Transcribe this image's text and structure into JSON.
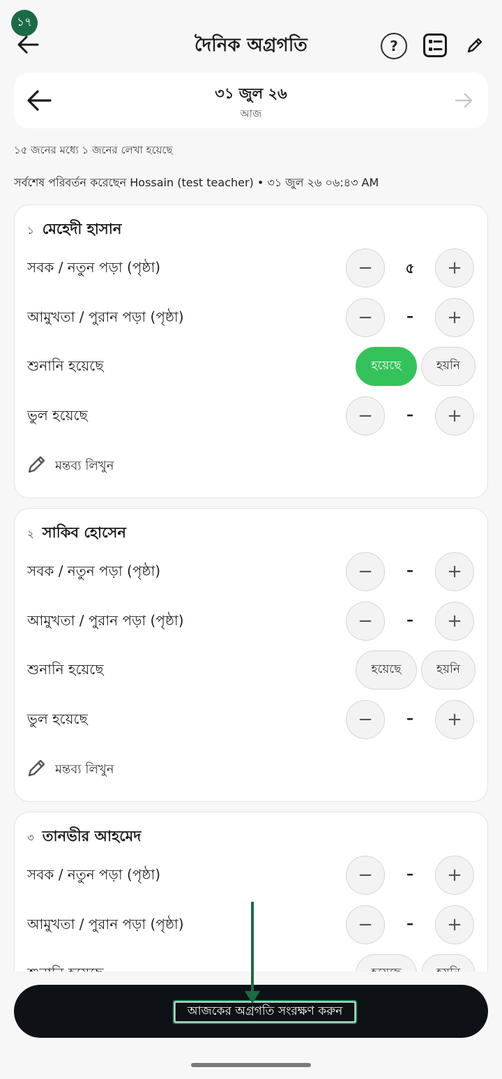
{
  "step_badge": "১৭",
  "header": {
    "title": "দৈনিক অগ্রগতি",
    "help_glyph": "?",
    "icons": [
      "back-arrow-icon",
      "help-icon",
      "list-icon",
      "pencil-icon"
    ]
  },
  "date_nav": {
    "date": "৩১ জুল ২৬",
    "sub": "আজ"
  },
  "summary": {
    "written": "১৫ জনের মধ্যে ১ জনের লেখা হয়েছে",
    "last_modified": "সর্বশেষ পরিবর্তন করেছেন Hossain (test teacher) • ৩১ জুল ২৬ ০৬:৪৩ AM"
  },
  "controls": {
    "minus": "−",
    "plus": "+",
    "comment_label": "মন্তব্য লিখুন"
  },
  "students": [
    {
      "index": "১",
      "name": "মেহেদী হাসান",
      "rows": [
        {
          "label": "সবক / নতুন পড়া (পৃষ্ঠা)",
          "value": "৫"
        },
        {
          "label": "আমুখতা / পুরান পড়া (পৃষ্ঠা)",
          "value": "–"
        },
        {
          "label": "শুনানি হয়েছে",
          "yes": "হয়েছে",
          "no": "হয়নি",
          "selected": "yes"
        },
        {
          "label": "ভুল হয়েছে",
          "value": "–"
        }
      ]
    },
    {
      "index": "২",
      "name": "সাকিব হোসেন",
      "rows": [
        {
          "label": "সবক / নতুন পড়া (পৃষ্ঠা)",
          "value": "–"
        },
        {
          "label": "আমুখতা / পুরান পড়া (পৃষ্ঠা)",
          "value": "–"
        },
        {
          "label": "শুনানি হয়েছে",
          "yes": "হয়েছে",
          "no": "হয়নি",
          "selected": "none"
        },
        {
          "label": "ভুল হয়েছে",
          "value": "–"
        }
      ]
    },
    {
      "index": "৩",
      "name": "তানভীর আহমেদ",
      "rows": [
        {
          "label": "সবক / নতুন পড়া (পৃষ্ঠা)",
          "value": "–"
        },
        {
          "label": "আমুখতা / পুরান পড়া (পৃষ্ঠা)",
          "value": "–"
        },
        {
          "label": "শুনানি হয়েছে",
          "yes": "হয়েছে",
          "no": "হয়নি",
          "selected": "none"
        }
      ]
    }
  ],
  "save_button": {
    "label": "আজকের অগ্রগতি সংরক্ষণ করুন"
  },
  "colors": {
    "accent_green": "#34c35a",
    "badge_green": "#1a6b45",
    "save_bg": "#0e1116"
  }
}
